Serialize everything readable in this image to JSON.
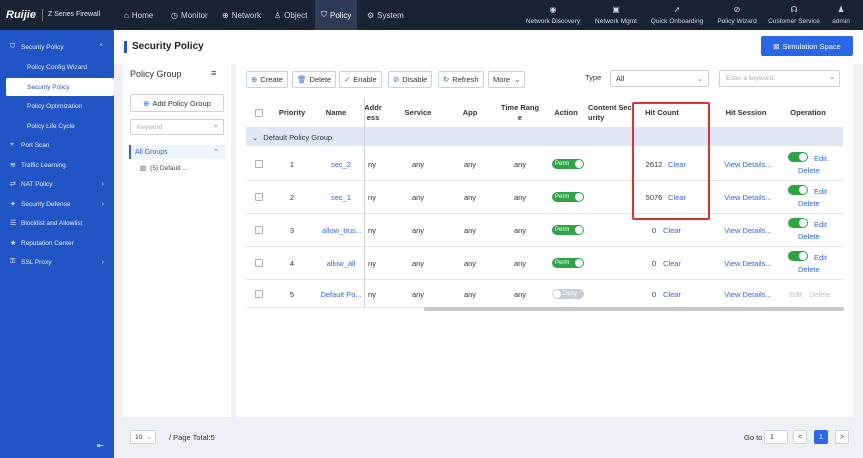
{
  "topbar": {
    "logo": "Ruijie",
    "product": "Z Series Firewall",
    "nav": [
      {
        "label": "Home",
        "icon": "home-icon"
      },
      {
        "label": "Monitor",
        "icon": "monitor-icon"
      },
      {
        "label": "Network",
        "icon": "globe-icon"
      },
      {
        "label": "Object",
        "icon": "users-icon"
      },
      {
        "label": "Policy",
        "icon": "shield-icon"
      },
      {
        "label": "System",
        "icon": "gear-icon"
      }
    ],
    "right_nav": [
      {
        "label": "Network Discovery",
        "icon": "radar-icon"
      },
      {
        "label": "Network Mgmt",
        "icon": "router-icon"
      },
      {
        "label": "Quick Onboarding",
        "icon": "rocket-icon"
      },
      {
        "label": "Policy Wizard",
        "icon": "compass-icon"
      },
      {
        "label": "Customer Service",
        "icon": "headset-icon"
      },
      {
        "label": "admin",
        "icon": "user-icon"
      }
    ]
  },
  "sidebar": {
    "items": [
      {
        "label": "Security Policy",
        "icon": "shield-icon"
      },
      {
        "label": "Policy Config Wizard"
      },
      {
        "label": "Security Policy"
      },
      {
        "label": "Policy Optimization"
      },
      {
        "label": "Policy Life Cycle"
      },
      {
        "label": "Port Scan",
        "icon": "scan-icon"
      },
      {
        "label": "Traffic Learning",
        "icon": "traffic-icon"
      },
      {
        "label": "NAT Policy",
        "icon": "nat-icon"
      },
      {
        "label": "Security Defense",
        "icon": "defense-icon"
      },
      {
        "label": "Blocklist and Allowlist",
        "icon": "list-icon"
      },
      {
        "label": "Reputation Center",
        "icon": "reputation-icon"
      },
      {
        "label": "SSL Proxy",
        "icon": "lock-icon"
      }
    ]
  },
  "page": {
    "title": "Security Policy",
    "simulation_btn": "Simulation Space"
  },
  "left_panel": {
    "title": "Policy Group",
    "add_btn": "Add Policy Group",
    "search_placeholder": "Keyword",
    "all_groups": "All Groups",
    "default_group": "(5) Default ..."
  },
  "toolbar": {
    "create": "Create",
    "delete": "Delete",
    "enable": "Enable",
    "disable": "Disable",
    "refresh": "Refresh",
    "more": "More",
    "type_label": "Type",
    "type_value": "All",
    "keyword_placeholder": "Enter a keyword."
  },
  "table": {
    "headers": {
      "priority": "Priority",
      "name": "Name",
      "addr": "Addr\ness",
      "service": "Service",
      "app": "App",
      "time": "Time Rang\ne",
      "action": "Action",
      "content": "Content Sec\nurity",
      "hit": "Hit Count",
      "session": "Hit Session",
      "operation": "Operation"
    },
    "group_label": "Default Policy Group",
    "rows": [
      {
        "priority": "1",
        "name": "sec_2",
        "addr": "ny",
        "service": "any",
        "app": "any",
        "time": "any",
        "action": "Perm",
        "hit": "2612",
        "clear": "Clear",
        "session": "View Details...",
        "edit": "Edit",
        "delete": "Delete"
      },
      {
        "priority": "2",
        "name": "sec_1",
        "addr": "ny",
        "service": "any",
        "app": "any",
        "time": "any",
        "action": "Perm",
        "hit": "5076",
        "clear": "Clear",
        "session": "View Details...",
        "edit": "Edit",
        "delete": "Delete"
      },
      {
        "priority": "3",
        "name": "allow_trus...",
        "addr": "ny",
        "service": "any",
        "app": "any",
        "time": "any",
        "action": "Perm",
        "hit": "0",
        "clear": "Clear",
        "session": "View Details...",
        "edit": "Edit",
        "delete": "Delete"
      },
      {
        "priority": "4",
        "name": "allow_all",
        "addr": "ny",
        "service": "any",
        "app": "any",
        "time": "any",
        "action": "Perm",
        "hit": "0",
        "clear": "Clear",
        "session": "View Details...",
        "edit": "Edit",
        "delete": "Delete"
      },
      {
        "priority": "5",
        "name": "Default Po...",
        "addr": "ny",
        "service": "any",
        "app": "any",
        "time": "any",
        "action": "Deny",
        "hit": "0",
        "clear": "Clear",
        "session": "View Details...",
        "edit": "Edit",
        "delete": "Delete"
      }
    ]
  },
  "footer": {
    "page_size": "10",
    "page_total": "/ Page Total:5",
    "goto": "Go to",
    "goto_value": "1",
    "current_page": "1",
    "prev": "<",
    "next": ">"
  },
  "colors": {
    "accent": "#2b66e8",
    "sidebar": "#2155c6",
    "topbar": "#1a2334",
    "highlight": "#e03131",
    "permit": "#2ea445"
  }
}
